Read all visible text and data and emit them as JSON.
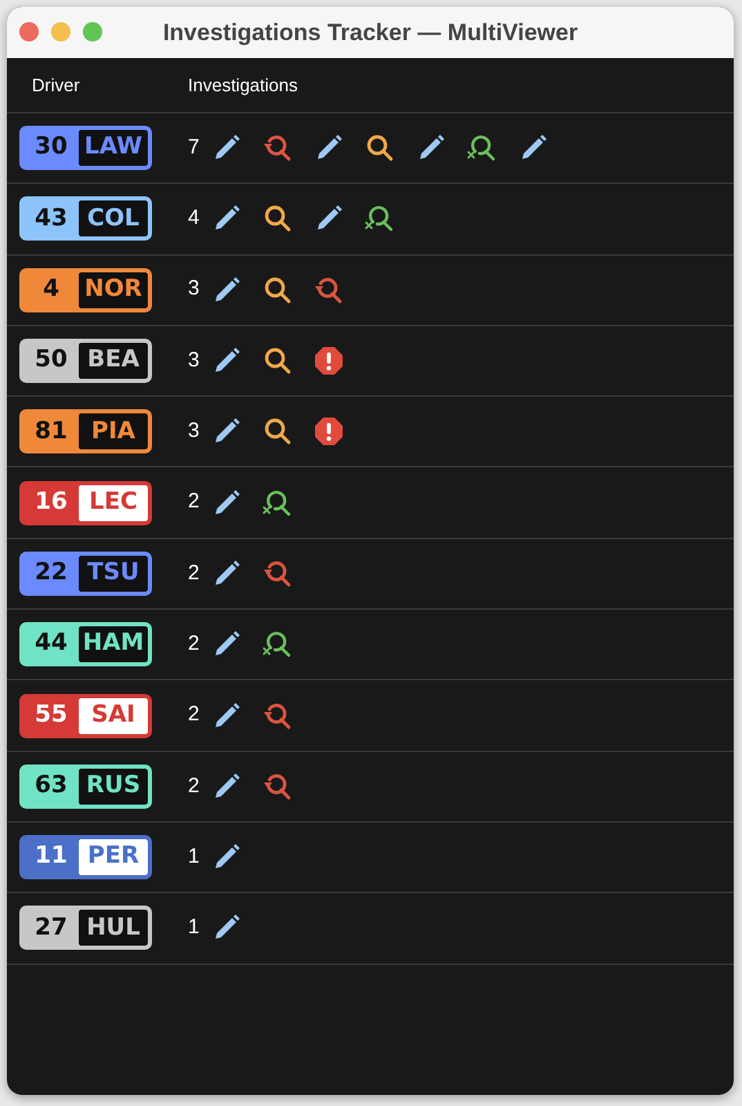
{
  "window": {
    "title": "Investigations Tracker — MultiViewer"
  },
  "table": {
    "columns": [
      "Driver",
      "Investigations"
    ],
    "rows": [
      {
        "number": "30",
        "code": "LAW",
        "color": "#6b8afd",
        "inverted": false,
        "count": "7",
        "items": [
          {
            "kind": "pencil"
          },
          {
            "kind": "undo"
          },
          {
            "kind": "pencil"
          },
          {
            "kind": "search"
          },
          {
            "kind": "pencil"
          },
          {
            "kind": "cleared"
          },
          {
            "kind": "pencil"
          }
        ]
      },
      {
        "number": "43",
        "code": "COL",
        "color": "#8cc4fb",
        "inverted": false,
        "count": "4",
        "items": [
          {
            "kind": "pencil"
          },
          {
            "kind": "search"
          },
          {
            "kind": "pencil"
          },
          {
            "kind": "cleared"
          }
        ]
      },
      {
        "number": "4",
        "code": "NOR",
        "color": "#f0883a",
        "inverted": false,
        "count": "3",
        "items": [
          {
            "kind": "pencil"
          },
          {
            "kind": "search"
          },
          {
            "kind": "undo"
          }
        ]
      },
      {
        "number": "50",
        "code": "BEA",
        "color": "#c6c7c9",
        "inverted": false,
        "count": "3",
        "items": [
          {
            "kind": "pencil"
          },
          {
            "kind": "search"
          },
          {
            "kind": "penalty"
          }
        ]
      },
      {
        "number": "81",
        "code": "PIA",
        "color": "#f0883a",
        "inverted": false,
        "count": "3",
        "items": [
          {
            "kind": "pencil"
          },
          {
            "kind": "search"
          },
          {
            "kind": "penalty"
          }
        ]
      },
      {
        "number": "16",
        "code": "LEC",
        "color": "#d53a36",
        "inverted": true,
        "count": "2",
        "items": [
          {
            "kind": "pencil"
          },
          {
            "kind": "cleared"
          }
        ]
      },
      {
        "number": "22",
        "code": "TSU",
        "color": "#6b8afd",
        "inverted": false,
        "count": "2",
        "items": [
          {
            "kind": "pencil"
          },
          {
            "kind": "undo"
          }
        ]
      },
      {
        "number": "44",
        "code": "HAM",
        "color": "#6fe3c4",
        "inverted": false,
        "count": "2",
        "items": [
          {
            "kind": "pencil"
          },
          {
            "kind": "cleared"
          }
        ]
      },
      {
        "number": "55",
        "code": "SAI",
        "color": "#d53a36",
        "inverted": true,
        "count": "2",
        "items": [
          {
            "kind": "pencil"
          },
          {
            "kind": "undo"
          }
        ]
      },
      {
        "number": "63",
        "code": "RUS",
        "color": "#6fe3c4",
        "inverted": false,
        "count": "2",
        "items": [
          {
            "kind": "pencil"
          },
          {
            "kind": "undo"
          }
        ]
      },
      {
        "number": "11",
        "code": "PER",
        "color": "#4c70c8",
        "inverted": true,
        "count": "1",
        "items": [
          {
            "kind": "pencil"
          }
        ]
      },
      {
        "number": "27",
        "code": "HUL",
        "color": "#c6c7c9",
        "inverted": false,
        "count": "1",
        "items": [
          {
            "kind": "pencil"
          }
        ]
      }
    ]
  }
}
